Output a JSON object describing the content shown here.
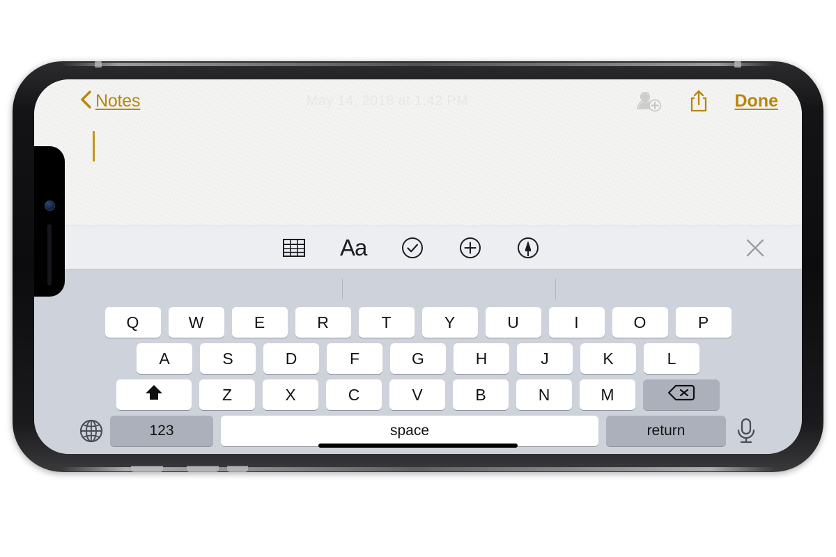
{
  "device": {
    "name": "iPhone X (landscape)",
    "notch_icons": [
      "front-camera",
      "earpiece-speaker"
    ]
  },
  "app": {
    "name": "Notes",
    "navbar": {
      "back_label": "Notes",
      "back_icon": "chevron-left-icon",
      "date_stamp": "May 14, 2018 at 1:42 PM",
      "actions": [
        {
          "icon": "add-person-icon",
          "label": "Add People",
          "state": "disabled"
        },
        {
          "icon": "share-icon",
          "label": "Share",
          "state": "enabled"
        }
      ],
      "done_label": "Done"
    },
    "note_body": {
      "text": "",
      "caret_visible": true,
      "caret_color": "#c59410"
    }
  },
  "format_toolbar": {
    "tools": [
      {
        "icon": "table-icon",
        "label": "Table"
      },
      {
        "icon": "text-format-icon",
        "label": "Aa"
      },
      {
        "icon": "checklist-icon",
        "label": "Checklist"
      },
      {
        "icon": "add-attachment-icon",
        "label": "Add"
      },
      {
        "icon": "markup-pen-icon",
        "label": "Markup"
      }
    ],
    "dismiss_icon": "close-x-icon",
    "dismiss_label": "Hide Keyboard"
  },
  "keyboard": {
    "predictive_bar": {
      "suggestions": [],
      "divider_count": 2
    },
    "rows": [
      {
        "keys": [
          "Q",
          "W",
          "E",
          "R",
          "T",
          "Y",
          "U",
          "I",
          "O",
          "P"
        ]
      },
      {
        "keys": [
          "A",
          "S",
          "D",
          "F",
          "G",
          "H",
          "J",
          "K",
          "L"
        ]
      },
      {
        "keys": [
          "Z",
          "X",
          "C",
          "V",
          "B",
          "N",
          "M"
        ]
      }
    ],
    "shift": {
      "icon": "shift-arrow-icon",
      "label": "Shift",
      "state": "active"
    },
    "delete": {
      "icon": "backspace-icon",
      "label": "Delete"
    },
    "numbers_label": "123",
    "space_label": "space",
    "return_label": "return",
    "globe": {
      "icon": "globe-icon",
      "label": "Next Keyboard"
    },
    "dictation": {
      "icon": "microphone-icon",
      "label": "Dictation"
    }
  },
  "colors": {
    "accent_gold": "#b8860b",
    "paper": "#f4f4f2",
    "keyboard_bg": "#ced2da",
    "toolbar_bg": "#eceef1",
    "key_white": "#ffffff",
    "key_dark": "#abb0ba"
  }
}
